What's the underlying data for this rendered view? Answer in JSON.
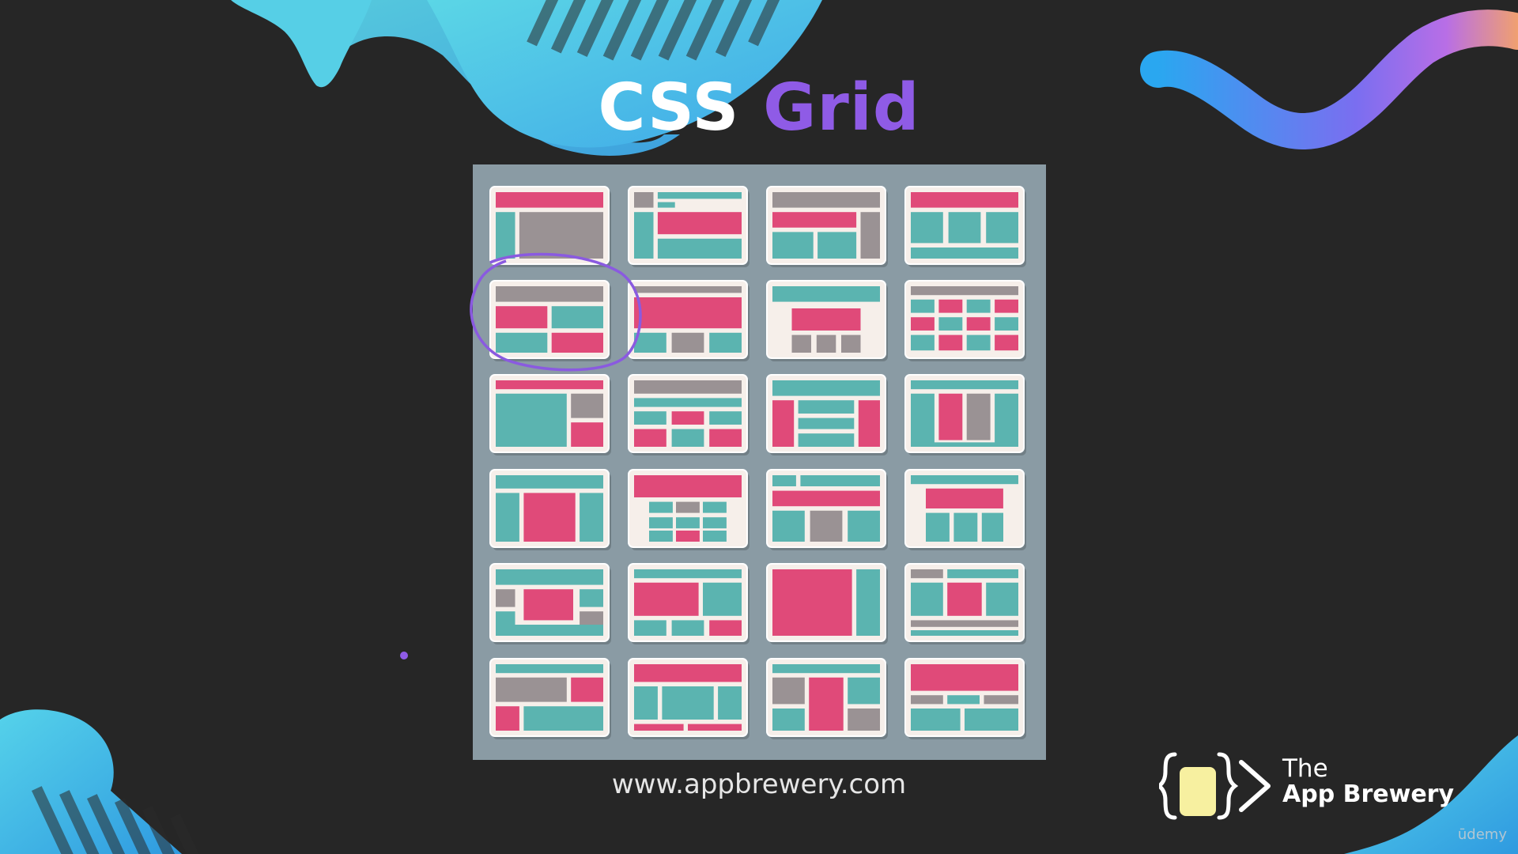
{
  "slide": {
    "title_part1": "CSS",
    "title_part2": "Grid",
    "url": "www.appbrewery.com",
    "brand_line1": "The",
    "brand_line2": "App Brewery",
    "watermark": "ūdemy"
  },
  "colors": {
    "background": "#262626",
    "panel": "#8a9ba4",
    "teal": "#5bb4b0",
    "pink": "#e04a79",
    "gray": "#9a9294",
    "card": "#f6efea",
    "accent_purple": "#8f5be6",
    "highlight_circle": "#8a5ae0"
  },
  "grid": {
    "rows": 6,
    "columns": 4,
    "highlighted_layout": "row 2, column 1",
    "layout_icons": "24 grid layout thumbnails"
  },
  "icons": [
    "curly-brace-logo-icon",
    "chevron-right-icon"
  ]
}
